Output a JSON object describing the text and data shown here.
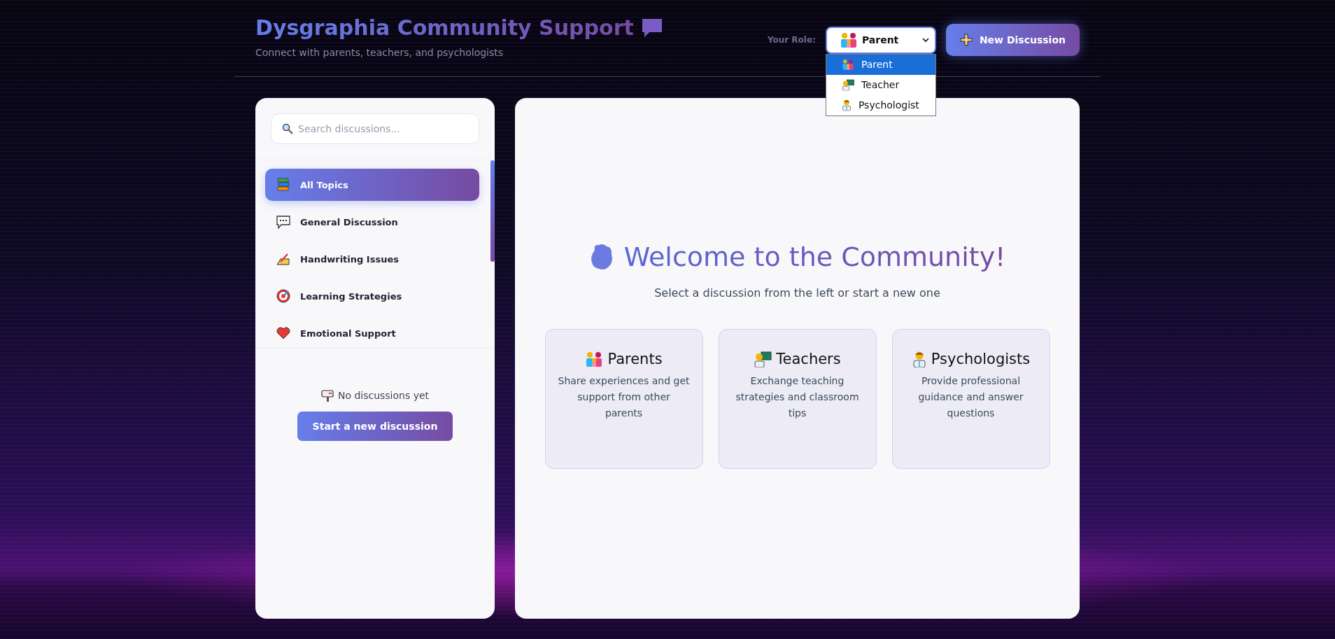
{
  "header": {
    "title": "Dysgraphia Community Support",
    "subtitle": "Connect with parents, teachers, and psychologists"
  },
  "role": {
    "label": "Your Role:",
    "value": "Parent",
    "expanded": true,
    "options": [
      {
        "label": "Parent",
        "selected": true
      },
      {
        "label": "Teacher",
        "selected": false
      },
      {
        "label": "Psychologist",
        "selected": false
      }
    ]
  },
  "new_button": "New Discussion",
  "sidebar": {
    "search": {
      "placeholder": "Search discussions..."
    },
    "topics": [
      {
        "label": "All Topics",
        "selected": true
      },
      {
        "label": "General Discussion",
        "selected": false
      },
      {
        "label": "Handwriting Issues",
        "selected": false
      },
      {
        "label": "Learning Strategies",
        "selected": false
      },
      {
        "label": "Emotional Support",
        "selected": false
      }
    ],
    "empty_text": "No discussions yet",
    "start_button": "Start a new discussion"
  },
  "welcome": {
    "title": "Welcome to the Community!",
    "subtitle": "Select a discussion from the left or start a new one",
    "cards": [
      {
        "title": "Parents",
        "text": "Share experiences and get support from other parents"
      },
      {
        "title": "Teachers",
        "text": "Exchange teaching strategies and classroom tips"
      },
      {
        "title": "Psychologists",
        "text": "Provide professional guidance and answer questions"
      }
    ]
  }
}
